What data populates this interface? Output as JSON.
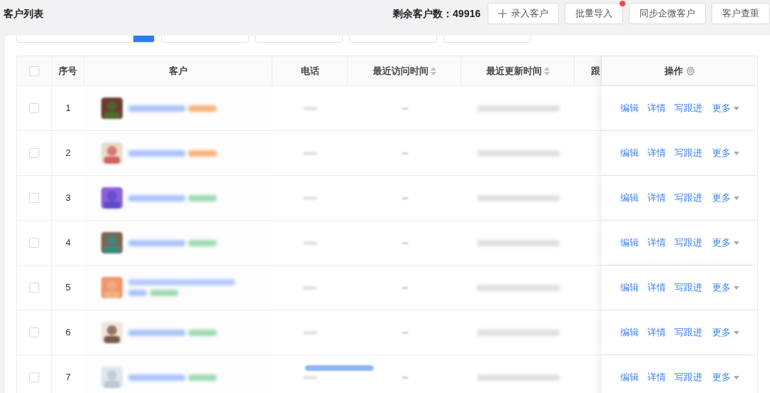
{
  "page_title": "客户列表",
  "remaining": {
    "label": "剩余客户数：",
    "count": "49916"
  },
  "buttons": [
    {
      "label": "录入客户",
      "kind": "add",
      "dot": false
    },
    {
      "label": "批量导入",
      "kind": "plain",
      "dot": true
    },
    {
      "label": "同步企微客户",
      "kind": "plain",
      "dot": false
    },
    {
      "label": "客户查重",
      "kind": "plain",
      "dot": false
    }
  ],
  "filters": [
    {
      "kind": "search"
    },
    {
      "kind": "select"
    },
    {
      "kind": "select"
    },
    {
      "kind": "select"
    },
    {
      "kind": "select"
    }
  ],
  "table": {
    "select_all": {
      "checked": false
    },
    "columns": [
      {
        "label": "序号"
      },
      {
        "label": "客户"
      },
      {
        "label": "电话"
      },
      {
        "label": "最近访问时间",
        "sortable": true
      },
      {
        "label": "最近更新时间",
        "sortable": true
      },
      {
        "label": "跟"
      },
      {
        "label": "操作",
        "settings": true
      }
    ],
    "rows": [
      {
        "index": "1",
        "checked": false,
        "avatar": {
          "kind": "picture"
        },
        "tag": {
          "color": "#f7b27a"
        },
        "actions": [
          "编辑",
          "详情",
          "写跟进",
          "更多"
        ]
      },
      {
        "index": "2",
        "checked": false,
        "avatar": {
          "kind": "picture"
        },
        "tag": {
          "color": "#f7b27a"
        },
        "actions": [
          "编辑",
          "详情",
          "写跟进",
          "更多"
        ]
      },
      {
        "index": "3",
        "checked": false,
        "avatar": {
          "kind": "picture"
        },
        "tag": {
          "color": "#9fd9b5"
        },
        "actions": [
          "编辑",
          "详情",
          "写跟进",
          "更多"
        ]
      },
      {
        "index": "4",
        "checked": false,
        "avatar": {
          "kind": "picture"
        },
        "tag": {
          "color": "#9fd9b5"
        },
        "actions": [
          "编辑",
          "详情",
          "写跟进",
          "更多"
        ]
      },
      {
        "index": "5",
        "checked": false,
        "avatar": {
          "kind": "picture"
        },
        "tag": {
          "color": "#9fd9b5"
        },
        "wrapped": true,
        "actions": [
          "编辑",
          "详情",
          "写跟进",
          "更多"
        ]
      },
      {
        "index": "6",
        "checked": false,
        "avatar": {
          "kind": "picture"
        },
        "tag": {
          "color": "#9fd9b5"
        },
        "actions": [
          "编辑",
          "详情",
          "写跟进",
          "更多"
        ]
      },
      {
        "index": "7",
        "checked": false,
        "avatar": {
          "kind": "picture"
        },
        "tag": {
          "color": "#9fd9b5"
        },
        "actions": [
          "编辑",
          "详情",
          "写跟进",
          "更多"
        ]
      }
    ]
  }
}
